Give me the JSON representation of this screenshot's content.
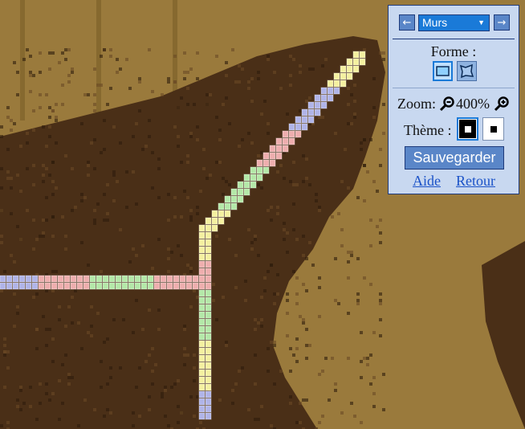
{
  "panel": {
    "layer": {
      "prev_icon": "←",
      "next_icon": "→",
      "selected": "Murs",
      "caret": "▼"
    },
    "shape": {
      "label": "Forme :",
      "options": [
        "rectangle-icon",
        "freeform-icon"
      ],
      "selected": "rectangle-icon"
    },
    "zoom": {
      "label": "Zoom:",
      "value": "400%",
      "out_icon": "zoom-out-icon",
      "in_icon": "zoom-in-icon"
    },
    "theme": {
      "label": "Thème :",
      "options": [
        "dark",
        "light"
      ],
      "selected": "dark"
    },
    "save_label": "Sauvegarder",
    "help_label": "Aide",
    "back_label": "Retour"
  },
  "map": {
    "terrain_colors": {
      "dirt": "#9a7a3c",
      "dirt_dark": "#86692f",
      "rock": "#4a2f17",
      "rock_dark": "#2f1c0c"
    },
    "wall_colors": {
      "yellow": "#f4f0a0",
      "blue": "#b0b4e8",
      "red": "#eeaeae",
      "green": "#b4e8a8"
    },
    "walls": [
      {
        "color": "yellow",
        "cells": [
          [
            55,
            6
          ],
          [
            56,
            6
          ],
          [
            54,
            7
          ],
          [
            55,
            7
          ],
          [
            56,
            7
          ],
          [
            53,
            8
          ],
          [
            54,
            8
          ],
          [
            55,
            8
          ],
          [
            52,
            9
          ],
          [
            53,
            9
          ],
          [
            54,
            9
          ],
          [
            51,
            10
          ],
          [
            52,
            10
          ],
          [
            53,
            10
          ]
        ]
      },
      {
        "color": "blue",
        "cells": [
          [
            50,
            11
          ],
          [
            51,
            11
          ],
          [
            52,
            11
          ],
          [
            49,
            12
          ],
          [
            50,
            12
          ],
          [
            51,
            12
          ],
          [
            48,
            13
          ],
          [
            49,
            13
          ],
          [
            50,
            13
          ],
          [
            47,
            14
          ],
          [
            48,
            14
          ],
          [
            49,
            14
          ],
          [
            46,
            15
          ],
          [
            47,
            15
          ],
          [
            48,
            15
          ],
          [
            45,
            16
          ],
          [
            46,
            16
          ],
          [
            47,
            16
          ]
        ]
      },
      {
        "color": "red",
        "cells": [
          [
            44,
            17
          ],
          [
            45,
            17
          ],
          [
            46,
            17
          ],
          [
            43,
            18
          ],
          [
            44,
            18
          ],
          [
            45,
            18
          ],
          [
            42,
            19
          ],
          [
            43,
            19
          ],
          [
            44,
            19
          ],
          [
            41,
            20
          ],
          [
            42,
            20
          ],
          [
            43,
            20
          ],
          [
            40,
            21
          ],
          [
            41,
            21
          ],
          [
            42,
            21
          ]
        ]
      },
      {
        "color": "green",
        "cells": [
          [
            39,
            22
          ],
          [
            40,
            22
          ],
          [
            41,
            22
          ],
          [
            38,
            23
          ],
          [
            39,
            23
          ],
          [
            40,
            23
          ],
          [
            37,
            24
          ],
          [
            38,
            24
          ],
          [
            39,
            24
          ],
          [
            36,
            25
          ],
          [
            37,
            25
          ],
          [
            38,
            25
          ],
          [
            35,
            26
          ],
          [
            36,
            26
          ],
          [
            37,
            26
          ],
          [
            34,
            27
          ],
          [
            35,
            27
          ],
          [
            36,
            27
          ]
        ]
      },
      {
        "color": "yellow",
        "cells": [
          [
            33,
            28
          ],
          [
            34,
            28
          ],
          [
            35,
            28
          ],
          [
            32,
            29
          ],
          [
            33,
            29
          ],
          [
            34,
            29
          ],
          [
            31,
            30
          ],
          [
            32,
            30
          ],
          [
            33,
            30
          ],
          [
            31,
            31
          ],
          [
            32,
            31
          ],
          [
            31,
            32
          ],
          [
            32,
            32
          ],
          [
            31,
            33
          ],
          [
            32,
            33
          ],
          [
            31,
            34
          ],
          [
            32,
            34
          ]
        ]
      },
      {
        "color": "red",
        "cells": [
          [
            31,
            35
          ],
          [
            32,
            35
          ],
          [
            31,
            36
          ],
          [
            32,
            36
          ],
          [
            31,
            37
          ],
          [
            32,
            37
          ],
          [
            31,
            38
          ],
          [
            32,
            38
          ]
        ]
      },
      {
        "color": "green",
        "cells": [
          [
            31,
            39
          ],
          [
            32,
            39
          ],
          [
            31,
            40
          ],
          [
            32,
            40
          ],
          [
            31,
            41
          ],
          [
            32,
            41
          ],
          [
            31,
            42
          ],
          [
            32,
            42
          ],
          [
            31,
            43
          ],
          [
            32,
            43
          ],
          [
            31,
            44
          ],
          [
            32,
            44
          ],
          [
            31,
            45
          ],
          [
            32,
            45
          ]
        ]
      },
      {
        "color": "yellow",
        "cells": [
          [
            31,
            46
          ],
          [
            32,
            46
          ],
          [
            31,
            47
          ],
          [
            32,
            47
          ],
          [
            31,
            48
          ],
          [
            32,
            48
          ],
          [
            31,
            49
          ],
          [
            32,
            49
          ],
          [
            31,
            50
          ],
          [
            32,
            50
          ],
          [
            31,
            51
          ],
          [
            32,
            51
          ],
          [
            31,
            52
          ],
          [
            32,
            52
          ]
        ]
      },
      {
        "color": "blue",
        "cells": [
          [
            31,
            53
          ],
          [
            32,
            53
          ],
          [
            31,
            54
          ],
          [
            32,
            54
          ],
          [
            31,
            55
          ],
          [
            32,
            55
          ],
          [
            31,
            56
          ],
          [
            32,
            56
          ]
        ]
      },
      {
        "color": "blue",
        "cells": [
          [
            0,
            37
          ],
          [
            1,
            37
          ],
          [
            2,
            37
          ],
          [
            3,
            37
          ],
          [
            4,
            37
          ],
          [
            5,
            37
          ],
          [
            0,
            38
          ],
          [
            1,
            38
          ],
          [
            2,
            38
          ],
          [
            3,
            38
          ],
          [
            4,
            38
          ],
          [
            5,
            38
          ]
        ]
      },
      {
        "color": "red",
        "cells": [
          [
            6,
            37
          ],
          [
            7,
            37
          ],
          [
            8,
            37
          ],
          [
            9,
            37
          ],
          [
            10,
            37
          ],
          [
            11,
            37
          ],
          [
            12,
            37
          ],
          [
            13,
            37
          ],
          [
            6,
            38
          ],
          [
            7,
            38
          ],
          [
            8,
            38
          ],
          [
            9,
            38
          ],
          [
            10,
            38
          ],
          [
            11,
            38
          ],
          [
            12,
            38
          ],
          [
            13,
            38
          ]
        ]
      },
      {
        "color": "green",
        "cells": [
          [
            14,
            37
          ],
          [
            15,
            37
          ],
          [
            16,
            37
          ],
          [
            17,
            37
          ],
          [
            18,
            37
          ],
          [
            19,
            37
          ],
          [
            20,
            37
          ],
          [
            21,
            37
          ],
          [
            22,
            37
          ],
          [
            23,
            37
          ],
          [
            14,
            38
          ],
          [
            15,
            38
          ],
          [
            16,
            38
          ],
          [
            17,
            38
          ],
          [
            18,
            38
          ],
          [
            19,
            38
          ],
          [
            20,
            38
          ],
          [
            21,
            38
          ],
          [
            22,
            38
          ],
          [
            23,
            38
          ]
        ]
      },
      {
        "color": "red",
        "cells": [
          [
            24,
            37
          ],
          [
            25,
            37
          ],
          [
            26,
            37
          ],
          [
            27,
            37
          ],
          [
            28,
            37
          ],
          [
            29,
            37
          ],
          [
            30,
            37
          ],
          [
            24,
            38
          ],
          [
            25,
            38
          ],
          [
            26,
            38
          ],
          [
            27,
            38
          ],
          [
            28,
            38
          ],
          [
            29,
            38
          ],
          [
            30,
            38
          ]
        ]
      }
    ]
  }
}
